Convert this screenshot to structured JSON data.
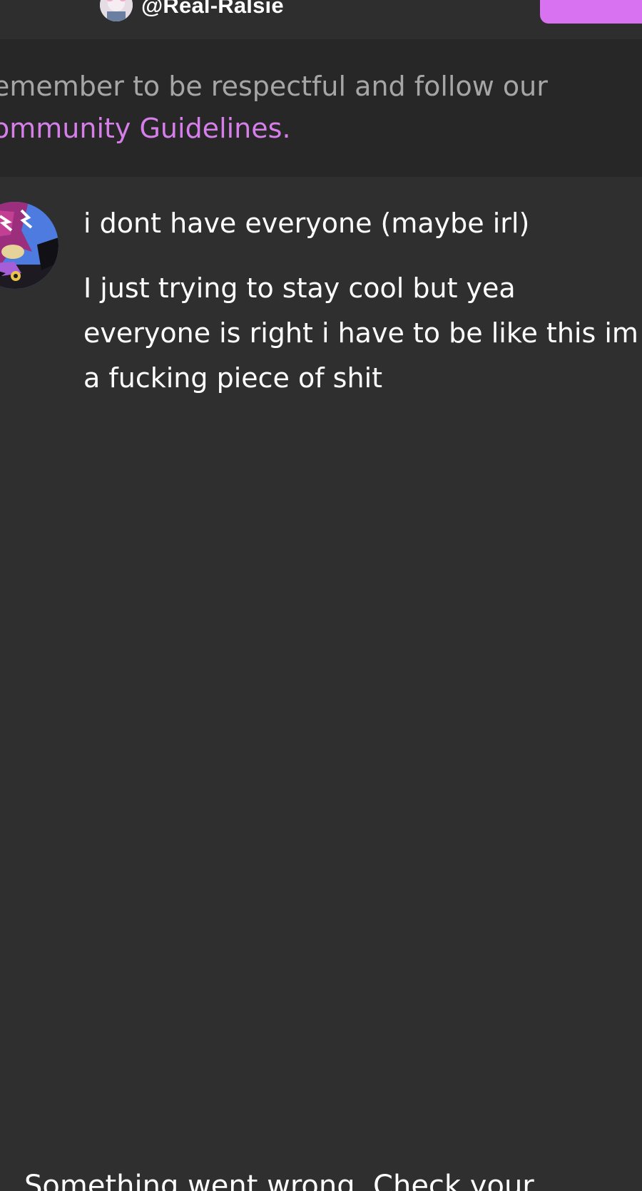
{
  "header": {
    "username": "@Real-Ralsie",
    "action_button_color": "#d872f0"
  },
  "banner": {
    "text": "emember to be respectful and follow our",
    "link_text": "ommunity Guidelines."
  },
  "comment": {
    "title": "i dont have everyone (maybe irl)",
    "body": "I just trying to stay cool but yea everyone is right i have to be like this im a fucking piece of shit"
  },
  "footer": {
    "partial_text": "Something went wrong. Check your"
  },
  "colors": {
    "background": "#2e2f2e",
    "banner_background": "#262726",
    "accent": "#d67ee9",
    "muted_text": "#a6a6a6"
  }
}
